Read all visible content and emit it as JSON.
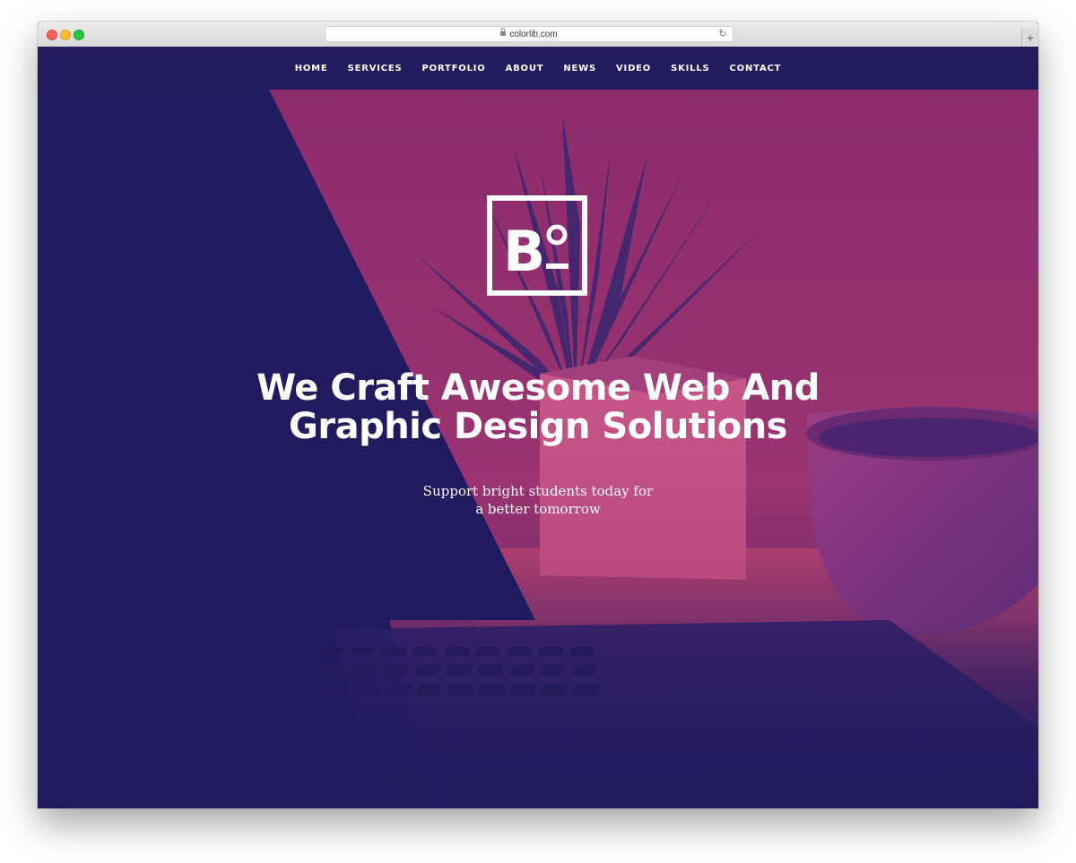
{
  "browser": {
    "url": "colorlib.com",
    "newtab_symbol": "+"
  },
  "nav": {
    "items": [
      {
        "label": "HOME"
      },
      {
        "label": "SERVICES"
      },
      {
        "label": "PORTFOLIO"
      },
      {
        "label": "ABOUT"
      },
      {
        "label": "NEWS"
      },
      {
        "label": "VIDEO"
      },
      {
        "label": "SKILLS"
      },
      {
        "label": "CONTACT"
      }
    ]
  },
  "hero": {
    "logo_letter": "B",
    "title_line1": "We Craft Awesome Web And",
    "title_line2": "Graphic Design Solutions",
    "subtitle_line1": "Support bright students today for",
    "subtitle_line2": "a better tomorrow"
  },
  "colors": {
    "navy": "#201b5e",
    "magenta": "#a0356f",
    "pink": "#c24c79",
    "white": "#ffffff"
  }
}
